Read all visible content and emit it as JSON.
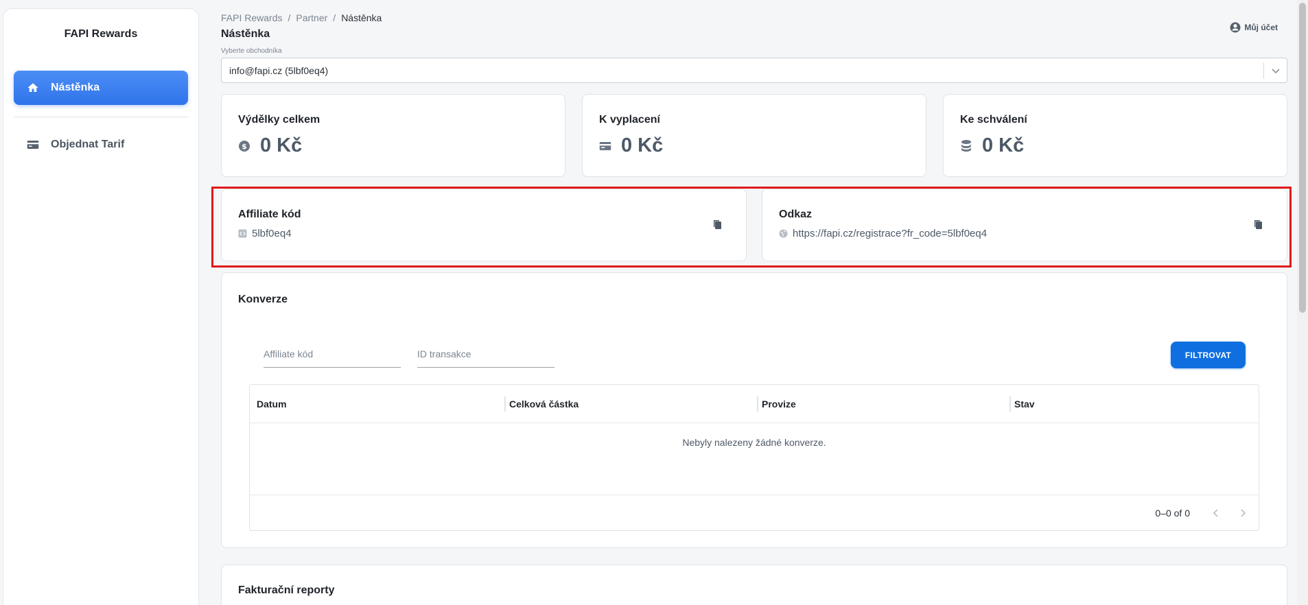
{
  "sidebar": {
    "brand": "FAPI Rewards",
    "items": [
      {
        "label": "Nástěnka",
        "icon": "home-icon",
        "active": true
      },
      {
        "label": "Objednat Tarif",
        "icon": "card-icon",
        "active": false
      }
    ]
  },
  "breadcrumb": [
    "FAPI Rewards",
    "Partner",
    "Nástěnka"
  ],
  "breadcrumb_separator": "/",
  "page_title": "Nástěnka",
  "account": {
    "label": "Můj účet",
    "icon": "user-circle-icon"
  },
  "merchant_select": {
    "label": "Vyberte obchodníka",
    "value": "info@fapi.cz (5lbf0eq4)"
  },
  "stats": [
    {
      "label": "Výdělky celkem",
      "value": "0 Kč",
      "icon": "dollar-circle-icon"
    },
    {
      "label": "K vyplacení",
      "value": "0 Kč",
      "icon": "credit-card-icon"
    },
    {
      "label": "Ke schválení",
      "value": "0 Kč",
      "icon": "coins-stack-icon"
    }
  ],
  "affiliate_code": {
    "label": "Affiliate kód",
    "value": "5lbf0eq4",
    "icon": "code-tag-icon"
  },
  "referral_link": {
    "label": "Odkaz",
    "value": "https://fapi.cz/registrace?fr_code=5lbf0eq4",
    "icon": "globe-icon"
  },
  "conversions": {
    "title": "Konverze",
    "filters": {
      "affiliate_placeholder": "Affiliate kód",
      "transaction_placeholder": "ID transakce",
      "button": "FILTROVAT"
    },
    "columns": [
      "Datum",
      "Celková částka",
      "Provize",
      "Stav"
    ],
    "empty_message": "Nebyly nalezeny žádné konverze.",
    "pagination": "0–0 of 0"
  },
  "invoices": {
    "title": "Fakturační reporty"
  },
  "colors": {
    "accent": "#2f74eb",
    "button": "#0f6fe0",
    "highlight": "#e0191b"
  }
}
